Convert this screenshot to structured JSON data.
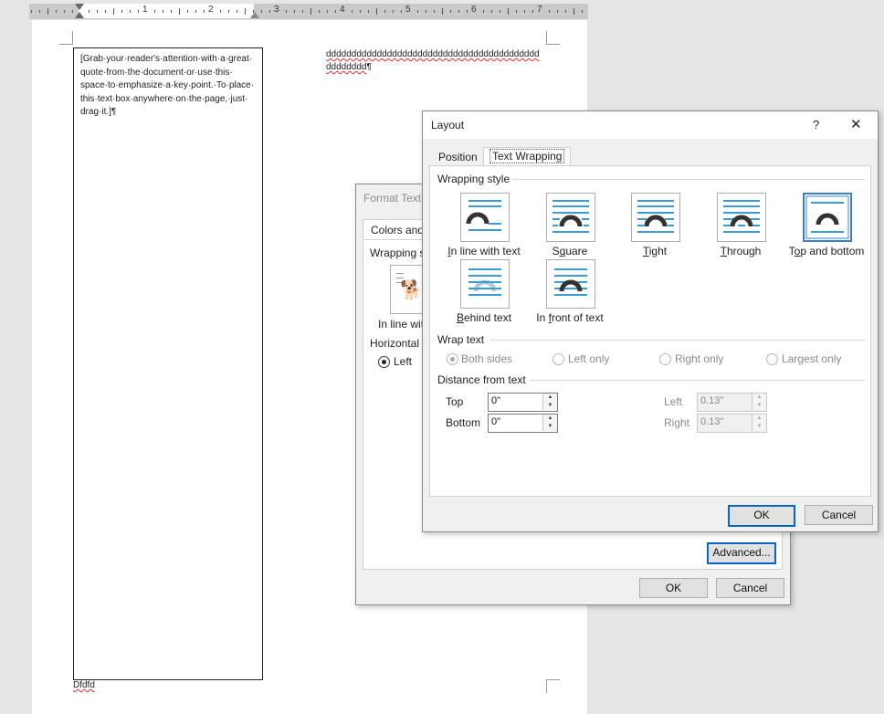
{
  "ruler": {
    "numbers": [
      "1",
      "2",
      "3",
      "4",
      "5",
      "6",
      "7"
    ]
  },
  "document": {
    "textbox_text": "[Grab·your·reader's·attention·with·a·great· quote·from·the·document·or·use·this· space·to·emphasize·a·key·point.·To·place· this·text·box·anywhere·on·the·page,·just· drag·it.]¶",
    "line1": "dddddddddddddddddddddddddddddddddddddddddd",
    "line2_word": "dddddddd",
    "line2_mark": "¶",
    "footer_text": "Dfdfd"
  },
  "format_dialog": {
    "title": "Format Text",
    "tab_colors": "Colors and",
    "wrapping_label": "Wrapping s",
    "inline_label": "In line wit",
    "horizontal_label": "Horizontal",
    "left_label": "Left",
    "advanced_button": "Advanced...",
    "ok_button": "OK",
    "cancel_button": "Cancel"
  },
  "layout_dialog": {
    "title": "Layout",
    "help": "?",
    "close": "✕",
    "tabs": [
      "Position",
      "Text Wrapping"
    ],
    "wrapping_style_label": "Wrapping style",
    "wrap_options": [
      {
        "label": "In line with text",
        "key": "I",
        "rest": "n line with text"
      },
      {
        "label": "Square",
        "pre": "S",
        "key": "q",
        "rest": "uare"
      },
      {
        "label": "Tight",
        "key": "T",
        "rest": "ight"
      },
      {
        "label": "Through",
        "key": "T",
        "rest": "hrough"
      },
      {
        "label": "Top and bottom",
        "pre": "T",
        "key": "o",
        "rest": "p and bottom"
      },
      {
        "label": "Behind text",
        "key": "B",
        "rest": "ehind text"
      },
      {
        "label": "In front of text",
        "pre": "In ",
        "key": "f",
        "rest": "ront of text"
      }
    ],
    "selected_wrap": "Top and bottom",
    "wrap_text_label": "Wrap text",
    "wrap_text_options": [
      "Both sides",
      "Left only",
      "Right only",
      "Largest only"
    ],
    "distance_label": "Distance from text",
    "top_label": "Top",
    "bottom_label": "Bottom",
    "left_label": "Left",
    "right_label": "Right",
    "top_value": "0\"",
    "bottom_value": "0\"",
    "left_value": "0.13\"",
    "right_value": "0.13\"",
    "ok_button": "OK",
    "cancel_button": "Cancel"
  },
  "colors": {
    "accent": "#3a9bd5",
    "selected_border": "#3a7fc8",
    "default_button": "#0a64c8"
  }
}
